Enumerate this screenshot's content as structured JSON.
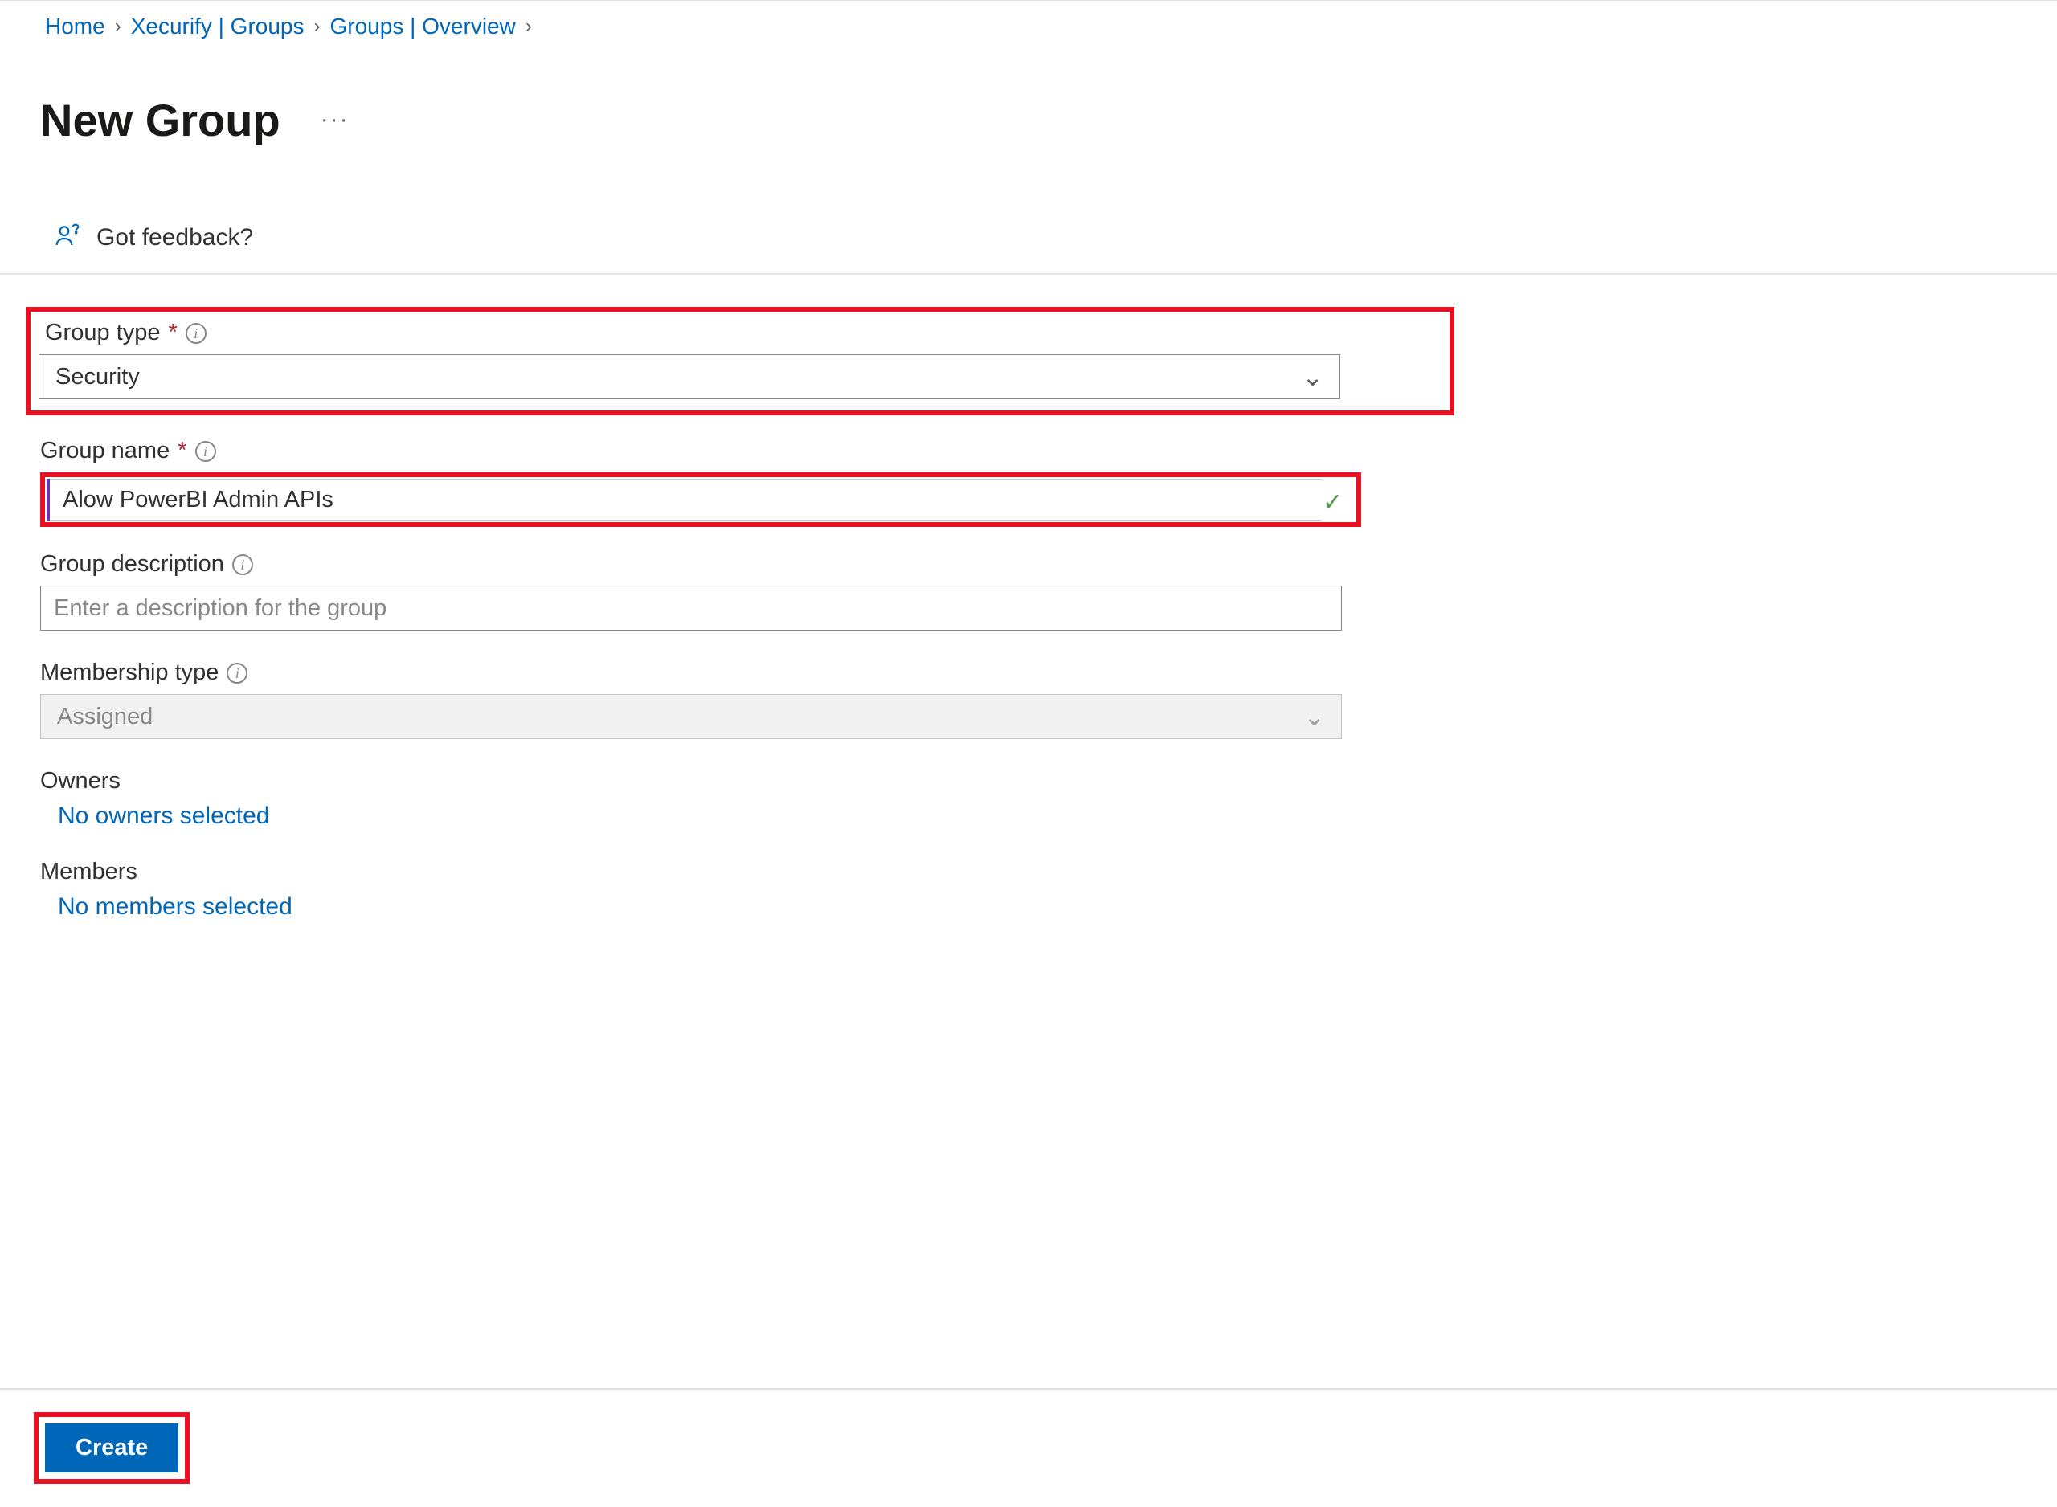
{
  "breadcrumb": {
    "items": [
      "Home",
      "Xecurify | Groups",
      "Groups | Overview"
    ]
  },
  "page": {
    "title": "New Group"
  },
  "feedback": {
    "label": "Got feedback?"
  },
  "form": {
    "group_type": {
      "label": "Group type",
      "value": "Security"
    },
    "group_name": {
      "label": "Group name",
      "value": "Alow PowerBI Admin APIs"
    },
    "group_description": {
      "label": "Group description",
      "placeholder": "Enter a description for the group",
      "value": ""
    },
    "membership_type": {
      "label": "Membership type",
      "value": "Assigned"
    },
    "owners": {
      "label": "Owners",
      "link": "No owners selected"
    },
    "members": {
      "label": "Members",
      "link": "No members selected"
    }
  },
  "buttons": {
    "create": "Create"
  }
}
